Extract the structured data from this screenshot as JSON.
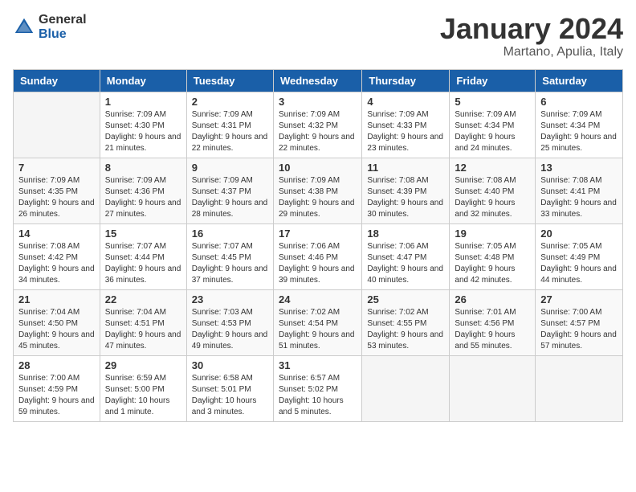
{
  "logo": {
    "general": "General",
    "blue": "Blue"
  },
  "header": {
    "title": "January 2024",
    "subtitle": "Martano, Apulia, Italy"
  },
  "days_of_week": [
    "Sunday",
    "Monday",
    "Tuesday",
    "Wednesday",
    "Thursday",
    "Friday",
    "Saturday"
  ],
  "weeks": [
    [
      {
        "date": "",
        "sunrise": "",
        "sunset": "",
        "daylight": ""
      },
      {
        "date": "1",
        "sunrise": "Sunrise: 7:09 AM",
        "sunset": "Sunset: 4:30 PM",
        "daylight": "Daylight: 9 hours and 21 minutes."
      },
      {
        "date": "2",
        "sunrise": "Sunrise: 7:09 AM",
        "sunset": "Sunset: 4:31 PM",
        "daylight": "Daylight: 9 hours and 22 minutes."
      },
      {
        "date": "3",
        "sunrise": "Sunrise: 7:09 AM",
        "sunset": "Sunset: 4:32 PM",
        "daylight": "Daylight: 9 hours and 22 minutes."
      },
      {
        "date": "4",
        "sunrise": "Sunrise: 7:09 AM",
        "sunset": "Sunset: 4:33 PM",
        "daylight": "Daylight: 9 hours and 23 minutes."
      },
      {
        "date": "5",
        "sunrise": "Sunrise: 7:09 AM",
        "sunset": "Sunset: 4:34 PM",
        "daylight": "Daylight: 9 hours and 24 minutes."
      },
      {
        "date": "6",
        "sunrise": "Sunrise: 7:09 AM",
        "sunset": "Sunset: 4:34 PM",
        "daylight": "Daylight: 9 hours and 25 minutes."
      }
    ],
    [
      {
        "date": "7",
        "sunrise": "Sunrise: 7:09 AM",
        "sunset": "Sunset: 4:35 PM",
        "daylight": "Daylight: 9 hours and 26 minutes."
      },
      {
        "date": "8",
        "sunrise": "Sunrise: 7:09 AM",
        "sunset": "Sunset: 4:36 PM",
        "daylight": "Daylight: 9 hours and 27 minutes."
      },
      {
        "date": "9",
        "sunrise": "Sunrise: 7:09 AM",
        "sunset": "Sunset: 4:37 PM",
        "daylight": "Daylight: 9 hours and 28 minutes."
      },
      {
        "date": "10",
        "sunrise": "Sunrise: 7:09 AM",
        "sunset": "Sunset: 4:38 PM",
        "daylight": "Daylight: 9 hours and 29 minutes."
      },
      {
        "date": "11",
        "sunrise": "Sunrise: 7:08 AM",
        "sunset": "Sunset: 4:39 PM",
        "daylight": "Daylight: 9 hours and 30 minutes."
      },
      {
        "date": "12",
        "sunrise": "Sunrise: 7:08 AM",
        "sunset": "Sunset: 4:40 PM",
        "daylight": "Daylight: 9 hours and 32 minutes."
      },
      {
        "date": "13",
        "sunrise": "Sunrise: 7:08 AM",
        "sunset": "Sunset: 4:41 PM",
        "daylight": "Daylight: 9 hours and 33 minutes."
      }
    ],
    [
      {
        "date": "14",
        "sunrise": "Sunrise: 7:08 AM",
        "sunset": "Sunset: 4:42 PM",
        "daylight": "Daylight: 9 hours and 34 minutes."
      },
      {
        "date": "15",
        "sunrise": "Sunrise: 7:07 AM",
        "sunset": "Sunset: 4:44 PM",
        "daylight": "Daylight: 9 hours and 36 minutes."
      },
      {
        "date": "16",
        "sunrise": "Sunrise: 7:07 AM",
        "sunset": "Sunset: 4:45 PM",
        "daylight": "Daylight: 9 hours and 37 minutes."
      },
      {
        "date": "17",
        "sunrise": "Sunrise: 7:06 AM",
        "sunset": "Sunset: 4:46 PM",
        "daylight": "Daylight: 9 hours and 39 minutes."
      },
      {
        "date": "18",
        "sunrise": "Sunrise: 7:06 AM",
        "sunset": "Sunset: 4:47 PM",
        "daylight": "Daylight: 9 hours and 40 minutes."
      },
      {
        "date": "19",
        "sunrise": "Sunrise: 7:05 AM",
        "sunset": "Sunset: 4:48 PM",
        "daylight": "Daylight: 9 hours and 42 minutes."
      },
      {
        "date": "20",
        "sunrise": "Sunrise: 7:05 AM",
        "sunset": "Sunset: 4:49 PM",
        "daylight": "Daylight: 9 hours and 44 minutes."
      }
    ],
    [
      {
        "date": "21",
        "sunrise": "Sunrise: 7:04 AM",
        "sunset": "Sunset: 4:50 PM",
        "daylight": "Daylight: 9 hours and 45 minutes."
      },
      {
        "date": "22",
        "sunrise": "Sunrise: 7:04 AM",
        "sunset": "Sunset: 4:51 PM",
        "daylight": "Daylight: 9 hours and 47 minutes."
      },
      {
        "date": "23",
        "sunrise": "Sunrise: 7:03 AM",
        "sunset": "Sunset: 4:53 PM",
        "daylight": "Daylight: 9 hours and 49 minutes."
      },
      {
        "date": "24",
        "sunrise": "Sunrise: 7:02 AM",
        "sunset": "Sunset: 4:54 PM",
        "daylight": "Daylight: 9 hours and 51 minutes."
      },
      {
        "date": "25",
        "sunrise": "Sunrise: 7:02 AM",
        "sunset": "Sunset: 4:55 PM",
        "daylight": "Daylight: 9 hours and 53 minutes."
      },
      {
        "date": "26",
        "sunrise": "Sunrise: 7:01 AM",
        "sunset": "Sunset: 4:56 PM",
        "daylight": "Daylight: 9 hours and 55 minutes."
      },
      {
        "date": "27",
        "sunrise": "Sunrise: 7:00 AM",
        "sunset": "Sunset: 4:57 PM",
        "daylight": "Daylight: 9 hours and 57 minutes."
      }
    ],
    [
      {
        "date": "28",
        "sunrise": "Sunrise: 7:00 AM",
        "sunset": "Sunset: 4:59 PM",
        "daylight": "Daylight: 9 hours and 59 minutes."
      },
      {
        "date": "29",
        "sunrise": "Sunrise: 6:59 AM",
        "sunset": "Sunset: 5:00 PM",
        "daylight": "Daylight: 10 hours and 1 minute."
      },
      {
        "date": "30",
        "sunrise": "Sunrise: 6:58 AM",
        "sunset": "Sunset: 5:01 PM",
        "daylight": "Daylight: 10 hours and 3 minutes."
      },
      {
        "date": "31",
        "sunrise": "Sunrise: 6:57 AM",
        "sunset": "Sunset: 5:02 PM",
        "daylight": "Daylight: 10 hours and 5 minutes."
      },
      {
        "date": "",
        "sunrise": "",
        "sunset": "",
        "daylight": ""
      },
      {
        "date": "",
        "sunrise": "",
        "sunset": "",
        "daylight": ""
      },
      {
        "date": "",
        "sunrise": "",
        "sunset": "",
        "daylight": ""
      }
    ]
  ]
}
